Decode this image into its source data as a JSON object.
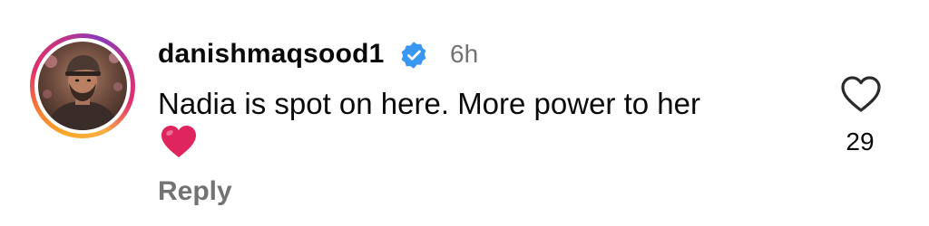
{
  "comment": {
    "username": "danishmaqsood1",
    "verified": true,
    "timestamp": "6h",
    "text": "Nadia is spot on here. More power to her",
    "emoji": "red-heart",
    "reply_label": "Reply",
    "like_count": "29"
  },
  "colors": {
    "verified_badge": "#3897f0",
    "secondary_text": "#737373",
    "heart_emoji": "#e0245e"
  },
  "icons": {
    "verified": "verified-badge-icon",
    "like": "heart-outline-icon",
    "emoji": "red-heart-emoji"
  }
}
